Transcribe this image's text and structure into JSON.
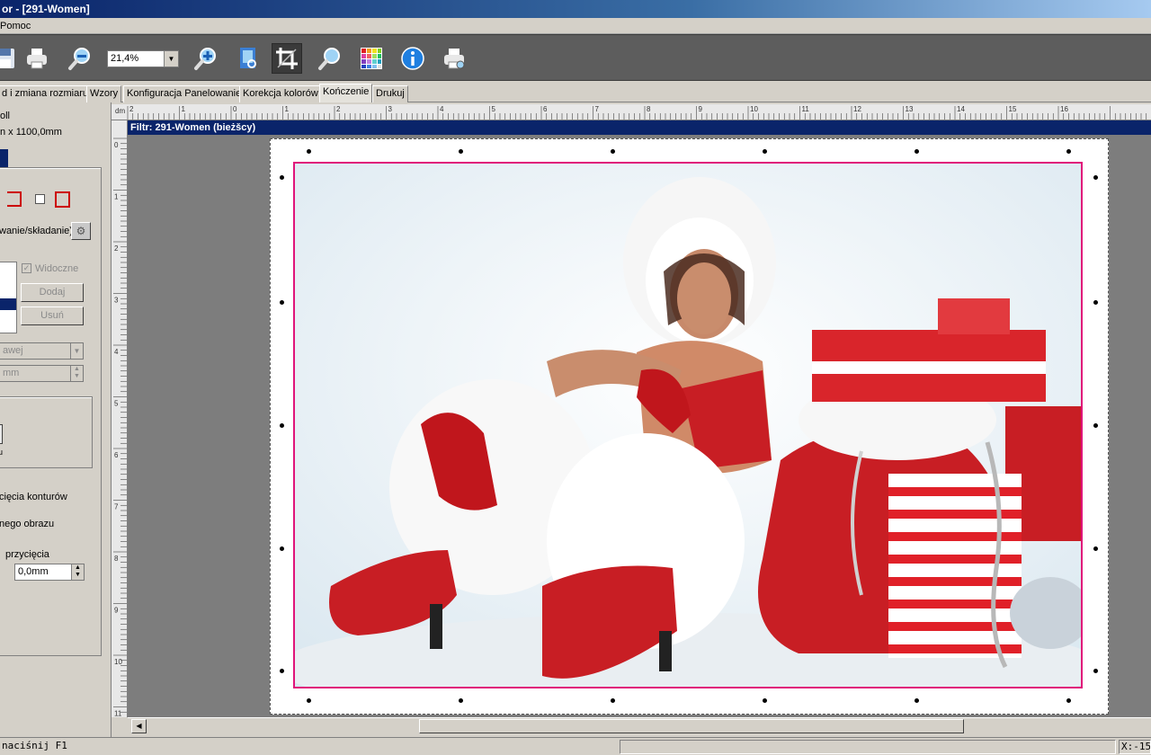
{
  "window": {
    "title": "or - [291-Women]"
  },
  "menu": {
    "items": [
      "Pomoc"
    ]
  },
  "toolbar": {
    "zoom_value": "21,4%",
    "icons": [
      "save-icon",
      "print-icon",
      "zoom-out-icon",
      "zoom-in-icon",
      "fit-page-icon",
      "crop-icon",
      "zoom-icon",
      "color-grid-icon",
      "info-icon",
      "print-preview-icon"
    ]
  },
  "tabs": [
    {
      "label": "d i zmiana rozmiaru"
    },
    {
      "label": "Wzory"
    },
    {
      "label": "Konfiguracja Panelowanie"
    },
    {
      "label": "Korekcja kolorów"
    },
    {
      "label": "Kończenie",
      "active": true
    },
    {
      "label": "Drukuj"
    }
  ],
  "left_panel": {
    "media_line1": "oll",
    "media_line2": "n x 1100,0mm",
    "option_line": "wanie/składanie)",
    "visible_label": "Widoczne",
    "add_button": "Dodaj",
    "remove_button": "Usuń",
    "select_value": "awej",
    "mm_value": "mm",
    "small_label": "u",
    "cut_contours": "cięcia konturów",
    "image_label": "nego obrazu",
    "crop_label": "przycięcia",
    "crop_value": "0,0mm"
  },
  "ruler": {
    "unit": "dm",
    "top_labels": [
      "2",
      "1",
      "0",
      "1",
      "2",
      "3",
      "4",
      "5",
      "6",
      "7",
      "8",
      "9",
      "10",
      "11",
      "12",
      "13",
      "14",
      "15",
      "16"
    ],
    "left_labels": [
      "0",
      "1",
      "2",
      "3",
      "4",
      "5",
      "6",
      "7",
      "8",
      "9",
      "10",
      "11"
    ]
  },
  "canvas": {
    "filter_title": "Filtr: 291-Women (bieżšcy)",
    "image_name": "291-Women"
  },
  "status": {
    "help": "naciśnij F1",
    "coords": "X:-15"
  },
  "colors": {
    "title_bar": "#0a246a",
    "toolbar_bg": "#5d5d5d",
    "crop_border": "#e0147a",
    "canvas_bg": "#7d7d7d"
  }
}
